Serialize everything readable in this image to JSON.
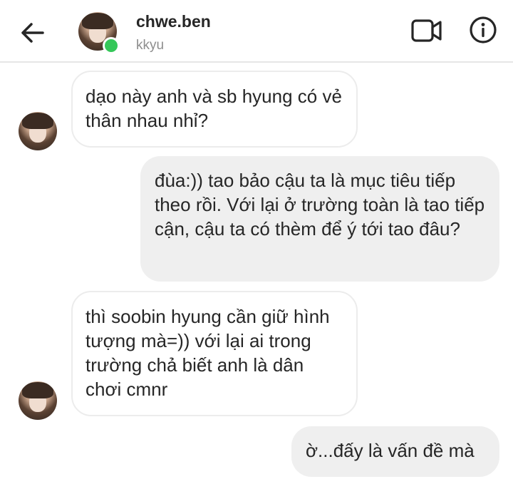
{
  "header": {
    "username": "chwe.ben",
    "subname": "kkyu",
    "online": true,
    "online_color": "#35c759",
    "back_icon": "arrow-left-icon",
    "video_icon": "video-camera-icon",
    "info_icon": "info-icon"
  },
  "messages": [
    {
      "direction": "in",
      "text": "dạo này anh và sb hyung có vẻ thân nhau nhỉ?"
    },
    {
      "direction": "out",
      "text": "đùa:)) tao bảo cậu ta là mục tiêu tiếp theo rồi. Với lại ở trường toàn là tao tiếp cận, cậu ta có thèm để ý tới tao đâu?"
    },
    {
      "direction": "in",
      "text": "thì soobin hyung cần giữ hình tượng mà=)) với lại ai trong trường chả biết anh là dân chơi cmnr"
    },
    {
      "direction": "out",
      "text": "ờ...đấy là vấn đề mà"
    }
  ],
  "colors": {
    "incoming_bubble_bg": "#ffffff",
    "incoming_bubble_border": "#ececec",
    "outgoing_bubble_bg": "#efefef",
    "text": "#262626",
    "muted_text": "#8e8e8e"
  }
}
